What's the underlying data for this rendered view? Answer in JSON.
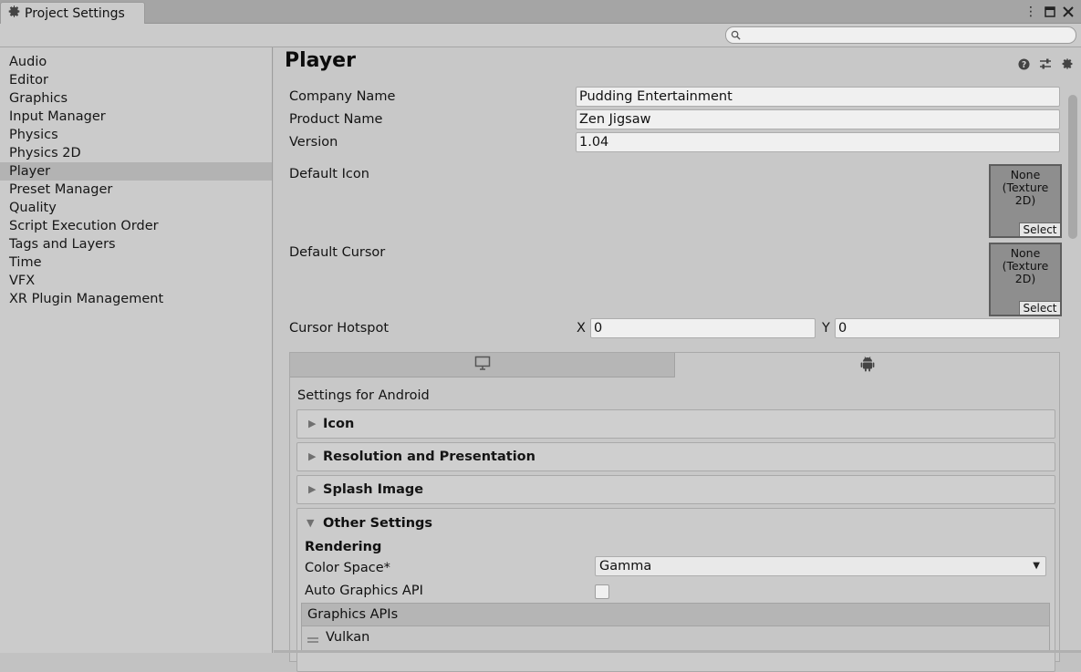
{
  "window": {
    "tab_title": "Project Settings",
    "controls": {
      "menu": "⋮",
      "maximize": "🗖",
      "close": "✕"
    }
  },
  "search": {
    "placeholder": "",
    "value": ""
  },
  "sidebar": {
    "items": [
      {
        "label": "Audio"
      },
      {
        "label": "Editor"
      },
      {
        "label": "Graphics"
      },
      {
        "label": "Input Manager"
      },
      {
        "label": "Physics"
      },
      {
        "label": "Physics 2D"
      },
      {
        "label": "Player",
        "active": true
      },
      {
        "label": "Preset Manager"
      },
      {
        "label": "Quality"
      },
      {
        "label": "Script Execution Order"
      },
      {
        "label": "Tags and Layers"
      },
      {
        "label": "Time"
      },
      {
        "label": "VFX"
      },
      {
        "label": "XR Plugin Management"
      }
    ]
  },
  "player": {
    "title": "Player",
    "header_icons": [
      "help-icon",
      "preset-sliders-icon",
      "gear-icon"
    ],
    "company_name_label": "Company Name",
    "company_name_value": "Pudding Entertainment",
    "product_name_label": "Product Name",
    "product_name_value": "Zen Jigsaw",
    "version_label": "Version",
    "version_value": "1.04",
    "default_icon_label": "Default Icon",
    "default_cursor_label": "Default Cursor",
    "texture_none_line1": "None",
    "texture_none_line2": "(Texture 2D)",
    "texture_select": "Select",
    "cursor_hotspot_label": "Cursor Hotspot",
    "hotspot_x_label": "X",
    "hotspot_x_value": "0",
    "hotspot_y_label": "Y",
    "hotspot_y_value": "0"
  },
  "platform": {
    "tabs": [
      {
        "icon": "monitor-icon",
        "active": false
      },
      {
        "icon": "android-icon",
        "active": true
      }
    ],
    "settings_for": "Settings for Android",
    "sections": [
      {
        "label": "Icon",
        "expanded": false
      },
      {
        "label": "Resolution and Presentation",
        "expanded": false
      },
      {
        "label": "Splash Image",
        "expanded": false
      },
      {
        "label": "Other Settings",
        "expanded": true
      }
    ],
    "other": {
      "rendering_header": "Rendering",
      "color_space_label": "Color Space*",
      "color_space_value": "Gamma",
      "auto_graphics_api_label": "Auto Graphics API",
      "auto_graphics_api_checked": false,
      "graphics_apis_header": "Graphics APIs",
      "graphics_apis": [
        "Vulkan"
      ]
    }
  },
  "colors": {
    "panel": "#cbcbcb",
    "field": "#f0f0f0",
    "selected_row": "#b3b3b3"
  }
}
